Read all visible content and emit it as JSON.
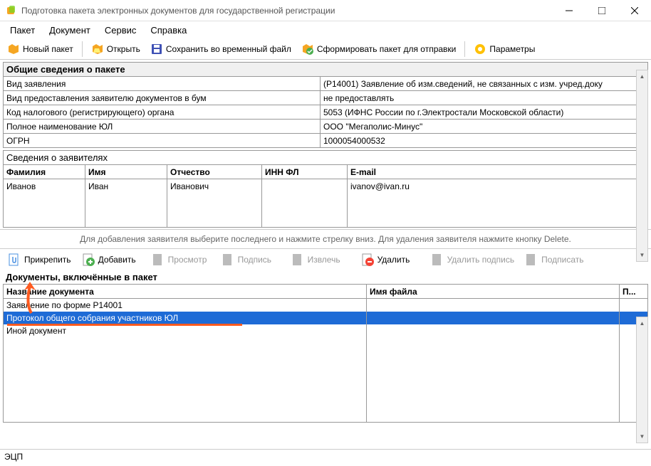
{
  "window": {
    "title": "Подготовка пакета электронных документов для государственной регистрации"
  },
  "menubar": {
    "items": [
      "Пакет",
      "Документ",
      "Сервис",
      "Справка"
    ]
  },
  "toolbar1": {
    "new_packet": "Новый пакет",
    "open": "Открыть",
    "save_temp": "Сохранить во временный файл",
    "form_packet": "Сформировать пакет для отправки",
    "params": "Параметры"
  },
  "general": {
    "header": "Общие сведения о пакете",
    "rows": [
      {
        "label": "Вид заявления",
        "value": "(Р14001) Заявление об изм.сведений, не связанных с изм. учред.доку"
      },
      {
        "label": "Вид предоставления заявителю документов в бум",
        "value": "не предоставлять"
      },
      {
        "label": "Код налогового (регистрирующего) органа",
        "value": "5053 (ИФНС России по г.Электростали Московской области)"
      },
      {
        "label": "Полное наименование ЮЛ",
        "value": "ООО \"Мегаполис-Минус\""
      },
      {
        "label": "ОГРН",
        "value": "1000054000532"
      }
    ]
  },
  "applicants": {
    "header": "Сведения о заявителях",
    "columns": [
      "Фамилия",
      "Имя",
      "Отчество",
      "ИНН ФЛ",
      "E-mail"
    ],
    "rows": [
      [
        "Иванов",
        "Иван",
        "Иванович",
        "",
        "ivanov@ivan.ru"
      ]
    ],
    "hint": "Для добавления заявителя выберите последнего и нажмите стрелку вниз. Для удаления заявителя нажмите кнопку Delete."
  },
  "toolbar2": {
    "attach": "Прикрепить",
    "add": "Добавить",
    "view": "Просмотр",
    "sign": "Подпись",
    "extract": "Извлечь",
    "delete": "Удалить",
    "remove_sign": "Удалить подпись",
    "sign_action": "Подписать"
  },
  "docs": {
    "header": "Документы, включённые в пакет",
    "columns": [
      "Название документа",
      "Имя файла",
      "П..."
    ],
    "rows": [
      {
        "name": "Заявление по форме Р14001",
        "file": "",
        "p": "",
        "selected": false
      },
      {
        "name": "Протокол общего собрания участников ЮЛ",
        "file": "",
        "p": "",
        "selected": true
      },
      {
        "name": "Иной документ",
        "file": "",
        "p": "",
        "selected": false
      }
    ]
  },
  "statusbar": {
    "text": "ЭЦП"
  }
}
